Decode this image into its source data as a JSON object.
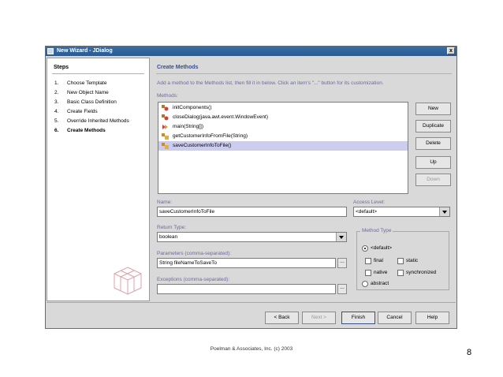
{
  "window": {
    "title": "New Wizard - JDialog",
    "close_label": "x"
  },
  "steps": {
    "header": "Steps",
    "items": [
      {
        "num": "1.",
        "label": "Choose Template"
      },
      {
        "num": "2.",
        "label": "New Object Name"
      },
      {
        "num": "3.",
        "label": "Basic Class Definition"
      },
      {
        "num": "4.",
        "label": "Create Fields"
      },
      {
        "num": "5.",
        "label": "Override Inherited Methods"
      },
      {
        "num": "6.",
        "label": "Create Methods"
      }
    ]
  },
  "panel": {
    "title": "Create Methods",
    "instructions": "Add a method to the Methods list, then fill it in below.  Click an item's \"...\" button for its customization.",
    "methods_label": "Methods:",
    "methods": [
      {
        "label": "initComponents()",
        "icon": "private-method-icon"
      },
      {
        "label": "closeDialog(java.awt.event.WindowEvent)",
        "icon": "private-method-icon"
      },
      {
        "label": "main(String[])",
        "icon": "static-method-icon"
      },
      {
        "label": "getCustomerInfoFromFile(String)",
        "icon": "method-icon"
      },
      {
        "label": "saveCustomerInfoToFile()",
        "icon": "method-icon"
      }
    ],
    "selected_index": 4,
    "buttons": {
      "new": "New",
      "duplicate": "Duplicate",
      "delete": "Delete",
      "up": "Up",
      "down": "Down"
    },
    "name_label": "Name:",
    "name_value": "saveCustomerInfoToFile",
    "access_label": "Access Level:",
    "access_value": "<default>",
    "return_label": "Return Type:",
    "return_value": "boolean",
    "params_label": "Parameters (comma-separated):",
    "params_value": "String fileNameToSaveTo",
    "exceptions_label": "Exceptions (comma-separated):",
    "exceptions_value": "",
    "browse_label": "...",
    "method_type": {
      "label": "Method Type",
      "default": "<default>",
      "final": "final",
      "static": "static",
      "native": "native",
      "synchronized": "synchronized",
      "abstract": "abstract"
    }
  },
  "nav": {
    "back": "< Back",
    "next": "Next >",
    "finish": "Finish",
    "cancel": "Cancel",
    "help": "Help"
  },
  "slide": {
    "footer": "Poelman & Associates, Inc. (c) 2003",
    "page": "8"
  },
  "colors": {
    "title_bar": "#2a5a94",
    "selection": "#ccccee",
    "label": "#6b6b9a",
    "section_title": "#3a4f8a"
  }
}
